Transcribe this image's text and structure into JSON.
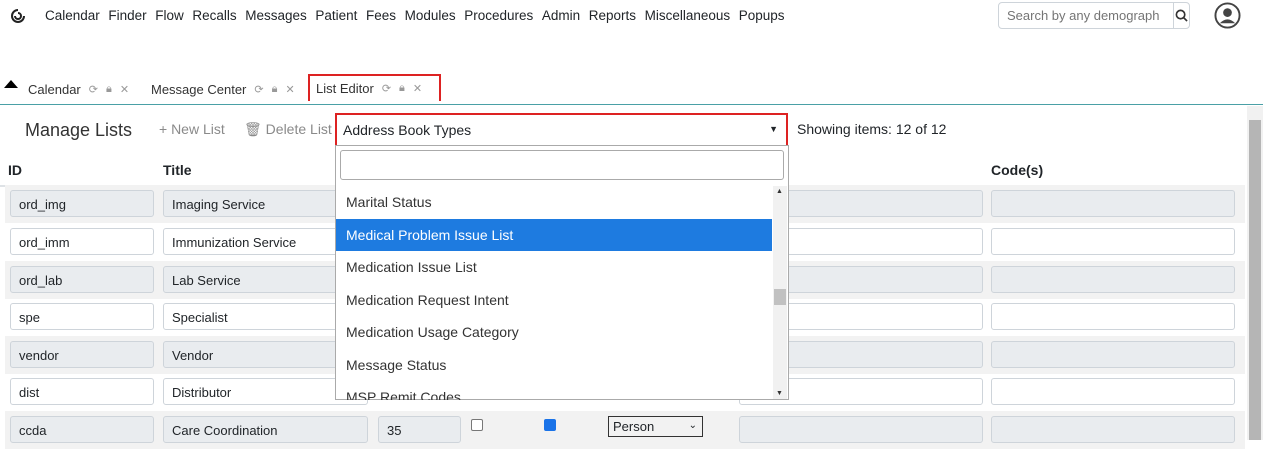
{
  "menu": [
    "Calendar",
    "Finder",
    "Flow",
    "Recalls",
    "Messages",
    "Patient",
    "Fees",
    "Modules",
    "Procedures",
    "Admin",
    "Reports",
    "Miscellaneous",
    "Popups"
  ],
  "search": {
    "placeholder": "Search by any demograph"
  },
  "tabs": [
    {
      "label": "Calendar"
    },
    {
      "label": "Message Center"
    },
    {
      "label": "List Editor"
    }
  ],
  "toolbar": {
    "title": "Manage Lists",
    "new_list": "+ New List",
    "delete_list": "Delete List",
    "selected_list": "Address Book Types",
    "showing": "Showing items: 12 of 12"
  },
  "columns": {
    "id": "ID",
    "title": "Title",
    "codes": "Code(s)"
  },
  "rows": [
    {
      "id": "ord_img",
      "title": "Imaging Service"
    },
    {
      "id": "ord_imm",
      "title": "Immunization Service"
    },
    {
      "id": "ord_lab",
      "title": "Lab Service"
    },
    {
      "id": "spe",
      "title": "Specialist"
    },
    {
      "id": "vendor",
      "title": "Vendor"
    },
    {
      "id": "dist",
      "title": "Distributor"
    },
    {
      "id": "ccda",
      "title": "Care Coordination",
      "order": "35",
      "type": "Person"
    }
  ],
  "dropdown": {
    "items": [
      "Marital Status",
      "Medical Problem Issue List",
      "Medication Issue List",
      "Medication Request Intent",
      "Medication Usage Category",
      "Message Status",
      "MSP Remit Codes"
    ],
    "highlighted": "Medical Problem Issue List"
  },
  "colors": {
    "highlight": "#1e7be0",
    "focus_border": "#dd2222"
  }
}
